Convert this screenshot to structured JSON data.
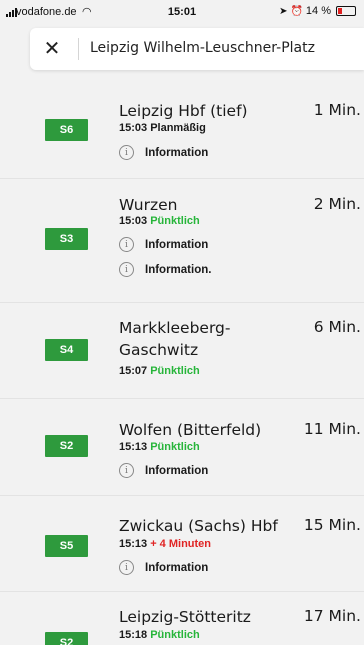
{
  "status_bar": {
    "carrier": "vodafone.de",
    "time": "15:01",
    "battery": "14 %",
    "battery_color": "#e02020"
  },
  "search": {
    "close_icon": "close-icon",
    "query": "Leipzig Wilhelm-Leuschner-Platz"
  },
  "colors": {
    "line_badge": "#2e9a3d",
    "on_time": "#27b53a",
    "delay": "#e02424"
  },
  "departures": [
    {
      "line": "S6",
      "destination": "Leipzig Hbf (tief)",
      "minutes": "1 Min.",
      "time": "15:03",
      "status": "Planmäßig",
      "infos": [
        "Information"
      ]
    },
    {
      "line": "S3",
      "destination": "Wurzen",
      "minutes": "2 Min.",
      "time": "15:03",
      "status": "Pünktlich",
      "infos": [
        "Information",
        "Information."
      ]
    },
    {
      "line": "S4",
      "destination_line1": "Markkleeberg-",
      "destination_line2": "Gaschwitz",
      "minutes": "6 Min.",
      "time": "15:07",
      "status": "Pünktlich",
      "infos": []
    },
    {
      "line": "S2",
      "destination": "Wolfen (Bitterfeld)",
      "minutes": "11 Min.",
      "time": "15:13",
      "status": "Pünktlich",
      "infos": [
        "Information"
      ]
    },
    {
      "line": "S5",
      "destination": "Zwickau (Sachs) Hbf",
      "minutes": "15 Min.",
      "time": "15:13",
      "status": "+ 4 Minuten",
      "infos": [
        "Information"
      ]
    },
    {
      "line": "S2",
      "destination": "Leipzig-Stötteritz",
      "minutes": "17 Min.",
      "time": "15:18",
      "status": "Pünktlich",
      "infos": []
    }
  ]
}
